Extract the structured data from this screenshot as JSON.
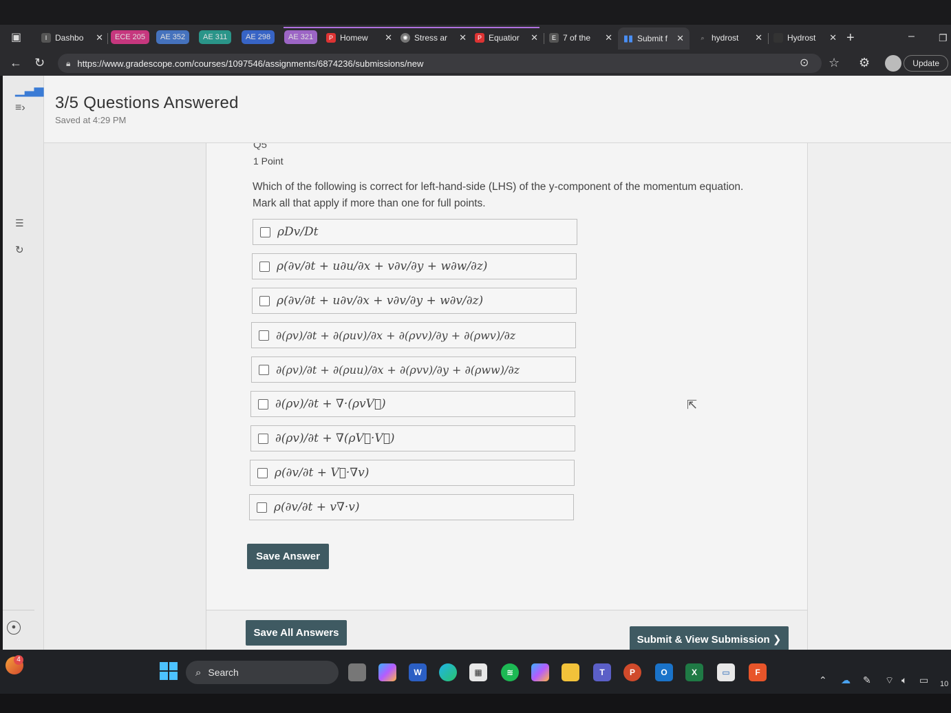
{
  "browser": {
    "tabs": [
      {
        "label": "Dashbo",
        "kind": "tab"
      },
      {
        "label": "ECE 205",
        "kind": "group",
        "color": "#e23a8c"
      },
      {
        "label": "AE 352",
        "kind": "group",
        "color": "#4a7fd6"
      },
      {
        "label": "AE 311",
        "kind": "group",
        "color": "#2aa89a"
      },
      {
        "label": "AE 298",
        "kind": "group",
        "color": "#3a6fe0"
      },
      {
        "label": "AE 321",
        "kind": "group",
        "color": "#b070e0"
      },
      {
        "label": "Homew",
        "kind": "tab"
      },
      {
        "label": "Stress ar",
        "kind": "tab"
      },
      {
        "label": "Equatior",
        "kind": "tab"
      },
      {
        "label": "7 of the",
        "kind": "tab"
      },
      {
        "label": "Submit f",
        "kind": "tab"
      },
      {
        "label": "hydrost",
        "kind": "tab"
      },
      {
        "label": "Hydrost",
        "kind": "tab"
      }
    ],
    "new_tab": "+",
    "close_glyph": "✕",
    "url": "https://www.gradescope.com/courses/1097546/assignments/6874236/submissions/new",
    "update_label": "Update"
  },
  "header": {
    "title": "3/5 Questions Answered",
    "saved_at": "Saved at 4:29 PM"
  },
  "question": {
    "label": "Q5",
    "points": "1 Point",
    "prompt": "Which of the following is correct for left-hand-side (LHS) of the y-component of the momentum equation. Mark all that apply if more than one for full points.",
    "options": [
      "ρDv/Dt",
      "ρ(∂v/∂t + u∂u/∂x + v∂v/∂y + w∂w/∂z)",
      "ρ(∂v/∂t + u∂v/∂x + v∂v/∂y + w∂v/∂z)",
      "∂(ρv)/∂t + ∂(ρuv)/∂x + ∂(ρvv)/∂y + ∂(ρwv)/∂z",
      "∂(ρv)/∂t + ∂(ρuu)/∂x + ∂(ρvv)/∂y + ∂(ρww)/∂z",
      "∂(ρv)/∂t + ∇·(ρvV⃗)",
      "∂(ρv)/∂t + ∇(ρV⃗·V⃗)",
      "ρ(∂v/∂t + V⃗·∇v)",
      "ρ(∂v/∂t + v∇·v)"
    ],
    "save_label": "Save Answer"
  },
  "footer": {
    "save_all_label": "Save All Answers",
    "submit_label": "Submit & View Submission ❯"
  },
  "taskbar": {
    "search_label": "Search",
    "clock_partial": "10",
    "notification_count": "4"
  }
}
